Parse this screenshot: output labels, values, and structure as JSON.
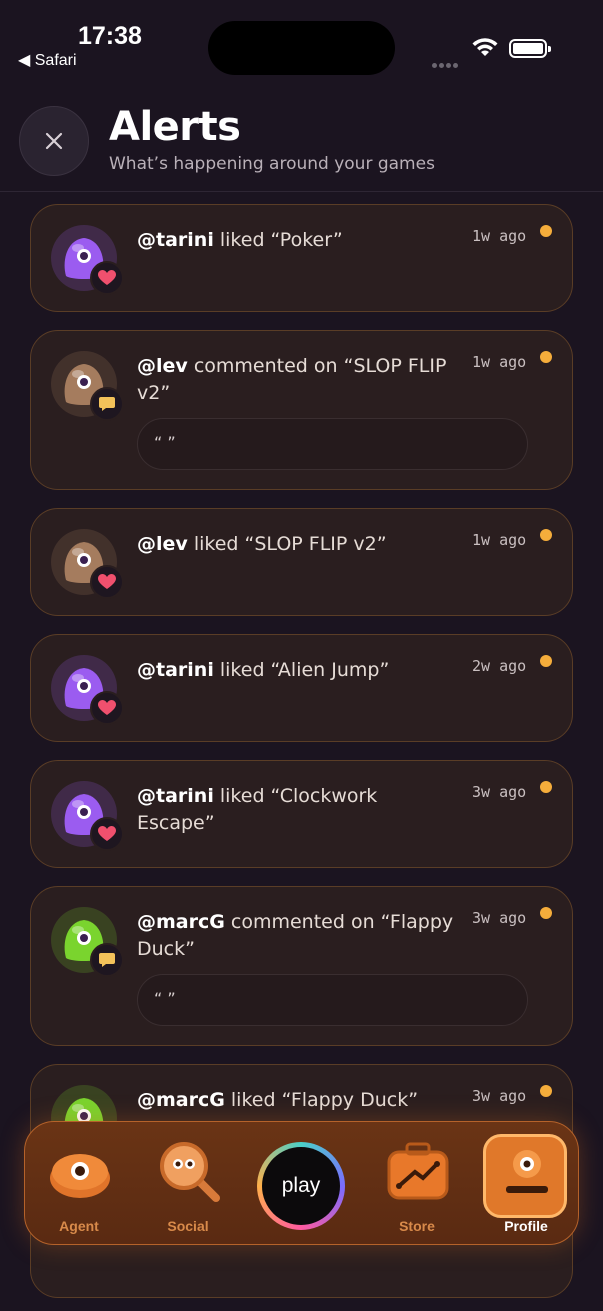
{
  "status_bar": {
    "time": "17:38",
    "back_app": "◀ Safari"
  },
  "header": {
    "title": "Alerts",
    "subtitle": "What’s happening around your games"
  },
  "alerts": [
    {
      "user": "@tarini",
      "action": " liked “Poker”",
      "time": "1w ago",
      "type": "like",
      "avatar_color": "#9b5cf0",
      "comment": null
    },
    {
      "user": "@lev",
      "action": " commented on “SLOP FLIP v2”",
      "time": "1w ago",
      "type": "comment",
      "avatar_color": "#a57c5e",
      "comment": "“ ”"
    },
    {
      "user": "@lev",
      "action": " liked “SLOP FLIP v2”",
      "time": "1w ago",
      "type": "like",
      "avatar_color": "#a57c5e",
      "comment": null
    },
    {
      "user": "@tarini",
      "action": " liked “Alien Jump”",
      "time": "2w ago",
      "type": "like",
      "avatar_color": "#9b5cf0",
      "comment": null
    },
    {
      "user": "@tarini",
      "action": " liked “Clockwork Escape”",
      "time": "3w ago",
      "type": "like",
      "avatar_color": "#9b5cf0",
      "comment": null
    },
    {
      "user": "@marcG",
      "action": " commented on “Flappy Duck”",
      "time": "3w ago",
      "type": "comment",
      "avatar_color": "#7ad42e",
      "comment": "“ ”"
    },
    {
      "user": "@marcG",
      "action": " liked “Flappy Duck”",
      "time": "3w ago",
      "type": "like",
      "avatar_color": "#7ad42e",
      "comment": null
    }
  ],
  "nav": {
    "agent": "Agent",
    "social": "Social",
    "play": "play",
    "store": "Store",
    "profile": "Profile"
  },
  "colors": {
    "unread": "#f5ad3b",
    "like": "#f0506e",
    "comment": "#f3c25a",
    "accent": "#e0782a"
  }
}
